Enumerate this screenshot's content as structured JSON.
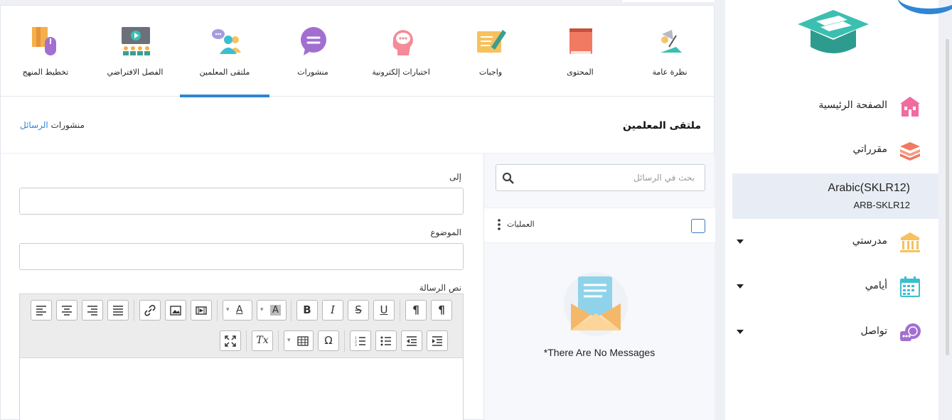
{
  "tabs": [
    {
      "label": "نظرة عامة",
      "icon": "lamp-icon"
    },
    {
      "label": "المحتوى",
      "icon": "book-icon"
    },
    {
      "label": "واجبات",
      "icon": "pen-paper-icon"
    },
    {
      "label": "اختبارات إلكترونية",
      "icon": "head-chat-icon"
    },
    {
      "label": "منشورات",
      "icon": "speech-bubble-icon"
    },
    {
      "label": "ملتقى المعلمين",
      "icon": "teachers-group-icon",
      "active": true
    },
    {
      "label": "الفصل الافتراضي",
      "icon": "virtual-class-icon"
    },
    {
      "label": "تخطيط المنهج",
      "icon": "curriculum-plan-icon"
    }
  ],
  "page": {
    "title": "ملتقى المعلمين",
    "link_messages": "الرسائل",
    "link_posts": "منشورات"
  },
  "form": {
    "to_label": "إلى",
    "subject_label": "الموضوع",
    "body_label": "نص الرسالة",
    "to_value": "",
    "subject_value": ""
  },
  "editor": {
    "row1": [
      "¶",
      "¶",
      "U",
      "S",
      "I",
      "B",
      "A",
      "A",
      "film",
      "image",
      "link",
      "justify",
      "right",
      "center",
      "left"
    ],
    "row2": [
      "indent",
      "outdent",
      "ul",
      "ol",
      "Ω",
      "table",
      "Tx",
      "fullscreen"
    ]
  },
  "messages": {
    "search_placeholder": "بحث في الرسائل",
    "operations_label": "العمليات",
    "empty_text": "*There Are No Messages"
  },
  "sidebar": {
    "nav": [
      {
        "label": "الصفحة الرئيسية",
        "icon": "home-school-icon"
      },
      {
        "label": "مقرراتي",
        "icon": "books-stack-icon"
      }
    ],
    "course": {
      "name": "Arabic(SKLR12)",
      "code": "ARB-SKLR12"
    },
    "groups": [
      {
        "label": "مدرستي",
        "icon": "school-building-icon"
      },
      {
        "label": "أيامي",
        "icon": "calendar-icon"
      },
      {
        "label": "تواصل",
        "icon": "chat-bubbles-icon"
      }
    ]
  },
  "colors": {
    "accent": "#2f86d4",
    "course_bg": "#e8edf5",
    "logo_teal": "#3bbfb0"
  }
}
